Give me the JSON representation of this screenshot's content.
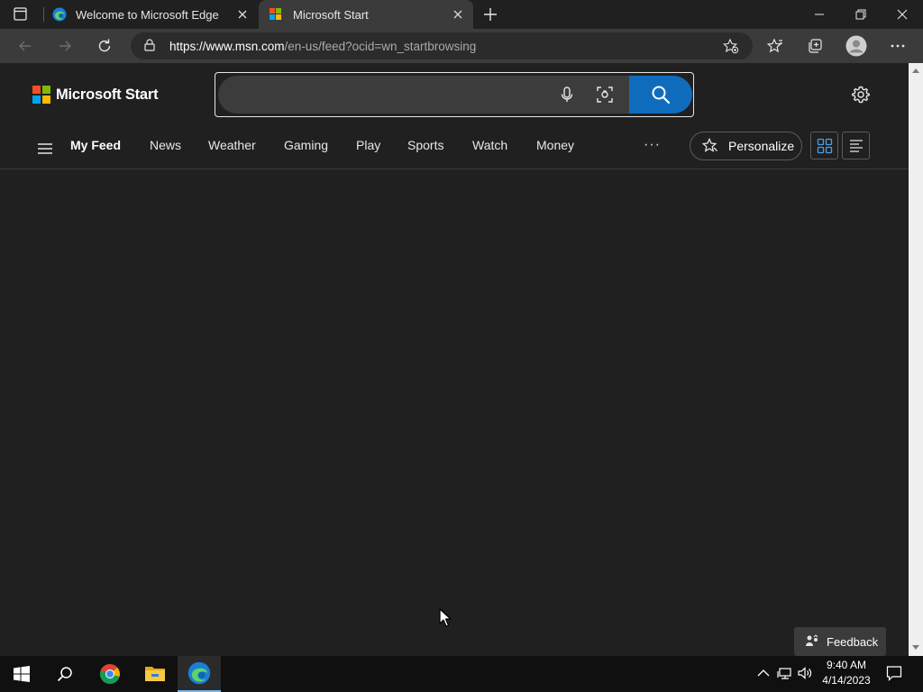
{
  "browser": {
    "tabs": [
      {
        "title": "Welcome to Microsoft Edge",
        "active": false
      },
      {
        "title": "Microsoft Start",
        "active": true
      }
    ],
    "address": {
      "host": "https://www.msn.com",
      "path": "/en-us/feed?ocid=wn_startbrowsing"
    }
  },
  "page": {
    "brand": "Microsoft Start",
    "search_placeholder": "",
    "nav": {
      "items": [
        "My Feed",
        "News",
        "Weather",
        "Gaming",
        "Play",
        "Sports",
        "Watch",
        "Money"
      ],
      "active": "My Feed",
      "more_label": "···",
      "personalize_label": "Personalize"
    },
    "feedback_label": "Feedback"
  },
  "taskbar": {
    "time": "9:40 AM",
    "date": "4/14/2023"
  },
  "colors": {
    "accent": "#0f6cbd",
    "ms_red": "#f25022",
    "ms_green": "#7fba00",
    "ms_blue": "#00a4ef",
    "ms_yellow": "#ffb900"
  }
}
